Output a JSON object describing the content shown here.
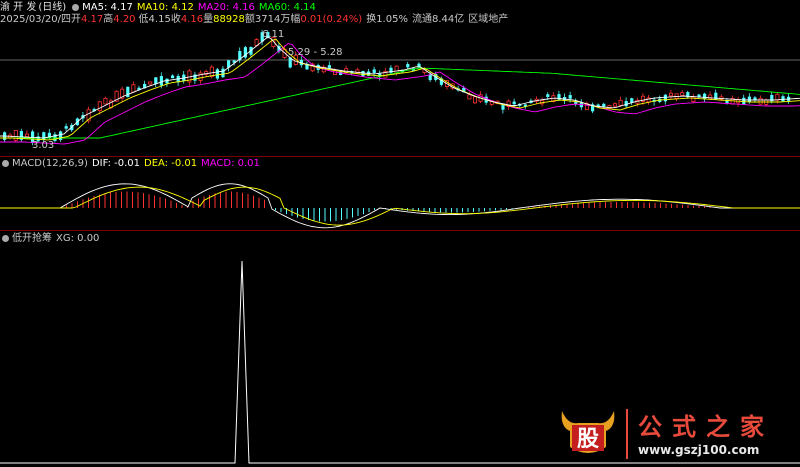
{
  "stock": {
    "name": "渝 开 发",
    "period": "(日线)",
    "date": "2025/03/20/四",
    "open_label": "开",
    "open": "4.17",
    "high_label": "高",
    "high": "4.20",
    "low_label": "低",
    "low": "4.15",
    "close_label": "收",
    "close": "4.16",
    "volume_label": "量",
    "volume": "88928",
    "amount_label": "额",
    "amount": "3714万",
    "change_label": "幅",
    "change": "0.01(0.24%)",
    "turnover_label": "换",
    "turnover": "1.05%",
    "float_label": "流通",
    "float_cap": "8.44亿",
    "sector": "区域地产"
  },
  "ma": [
    {
      "label": "MA5: 4.17",
      "color": "#ffffff"
    },
    {
      "label": "MA10: 4.12",
      "color": "#ffff00"
    },
    {
      "label": "MA20: 4.16",
      "color": "#ff00ff"
    },
    {
      "label": "MA60: 4.14",
      "color": "#00ff00"
    }
  ],
  "price_annotations": {
    "high_mark": "6.11",
    "low_mark": "3.03",
    "range_mark": "5.29 - 5.28"
  },
  "macd": {
    "title": "MACD(12,26,9)",
    "dif": "DIF: -0.01",
    "dea": "DEA: -0.01",
    "macd": "MACD: 0.01",
    "colors": {
      "dif": "#ffffff",
      "dea": "#ffff00",
      "macd": "#ff00ff"
    }
  },
  "indicator": {
    "title": "低开抢筹",
    "xg": "XG: 0.00",
    "signal_value": 1
  },
  "watermark": {
    "logo_char": "股",
    "title": "公式之家",
    "url": "www.gszj100.com"
  },
  "colors": {
    "up": "#ff3232",
    "down": "#54ffff",
    "separator": "#7a0000",
    "background": "#000000"
  }
}
